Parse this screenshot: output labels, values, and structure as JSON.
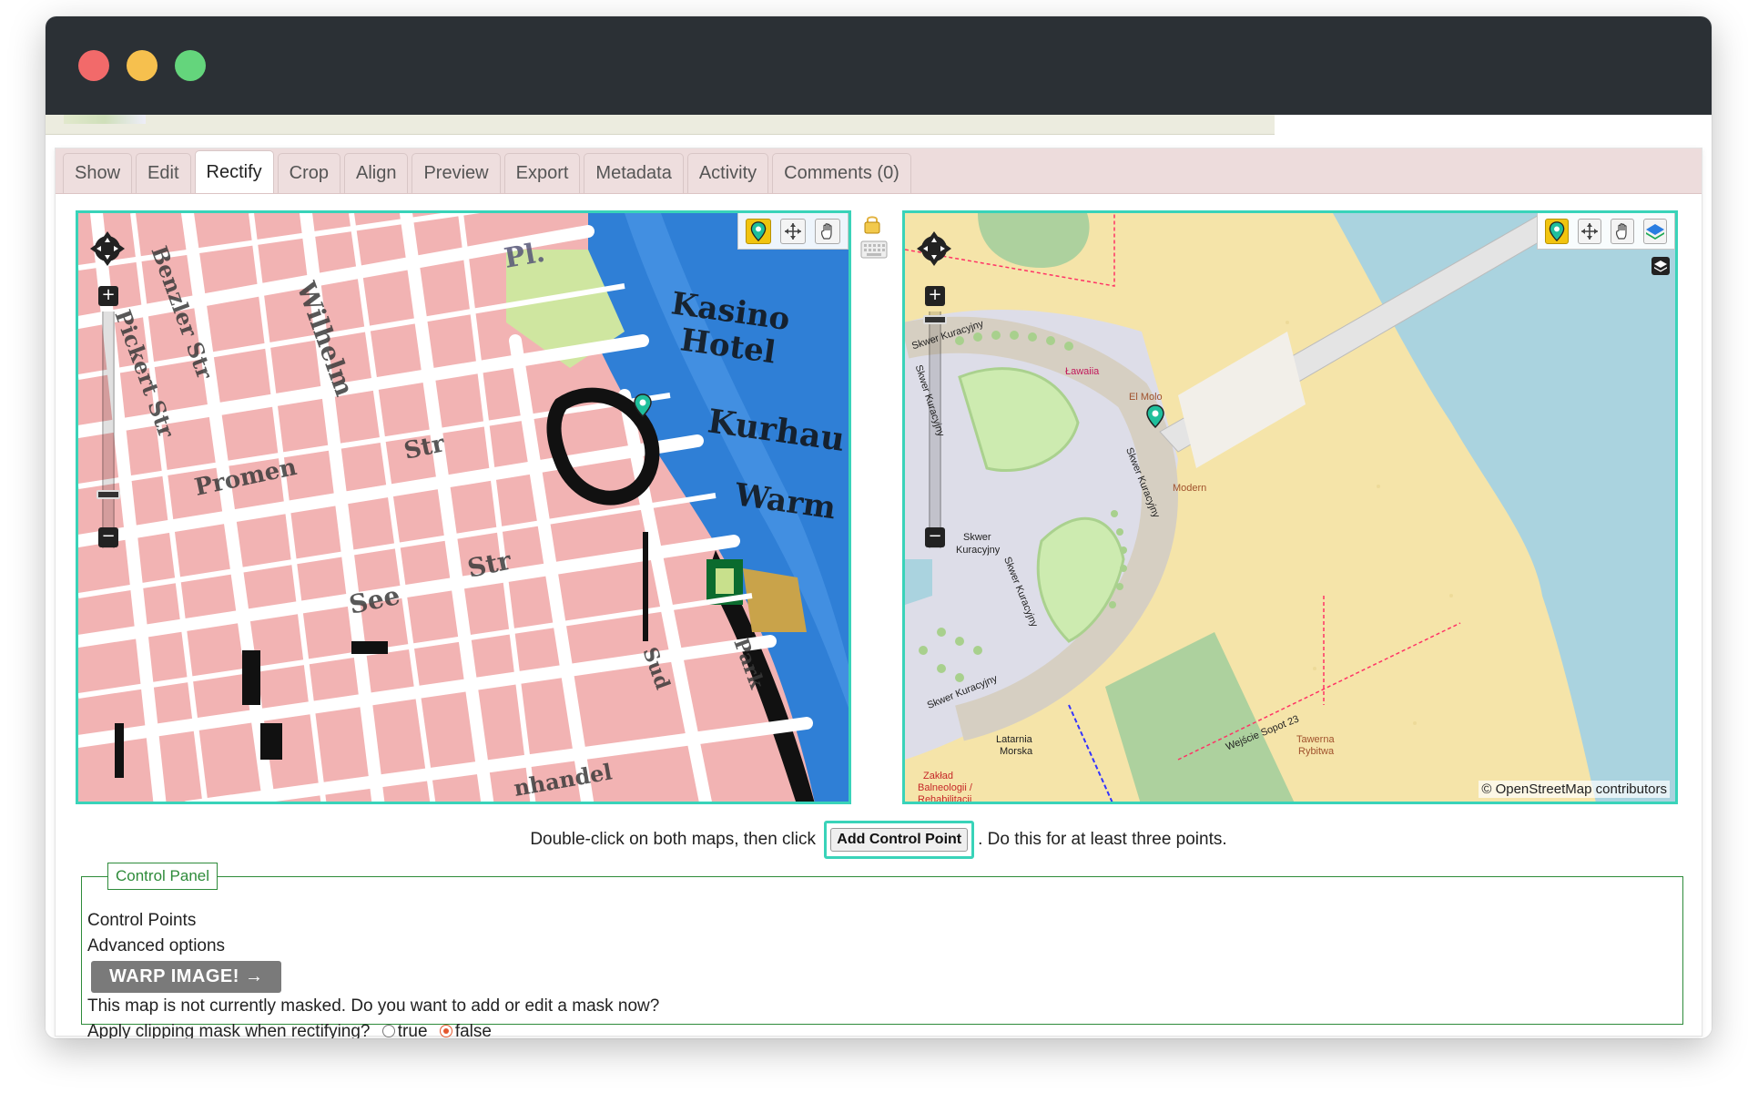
{
  "tabs": [
    {
      "label": "Show"
    },
    {
      "label": "Edit"
    },
    {
      "label": "Rectify"
    },
    {
      "label": "Crop"
    },
    {
      "label": "Align"
    },
    {
      "label": "Preview"
    },
    {
      "label": "Export"
    },
    {
      "label": "Metadata"
    },
    {
      "label": "Activity"
    },
    {
      "label": "Comments (0)"
    }
  ],
  "active_tab": "Rectify",
  "left_map": {
    "icons": [
      "pan-icon",
      "zoom-in-icon",
      "zoom-out-icon",
      "add-point-icon",
      "move-icon",
      "hand-icon"
    ]
  },
  "right_map": {
    "labels": {
      "skwer1": "Skwer Kuracyjny",
      "skwer2": "Skwer Kuracyjny",
      "skwer3": "Skwer Kuracyjny",
      "skwer4a": "Skwer",
      "skwer4b": "Kuracyjny",
      "skwer5": "Skwer Kuracyjny",
      "skwer6": "Skwer Kuracyjny",
      "lawaiia": "Ławaiia",
      "elmolo": "El Molo",
      "modern": "Modern",
      "latarnia1": "Latarnia",
      "latarnia2": "Morska",
      "zaklad1": "Zakład",
      "zaklad2": "Balneologii /",
      "zaklad3": "Rehabilitacji",
      "wejscie": "Wejście Sopot 23",
      "tawerna1": "Tawerna",
      "tawerna2": "Rybitwa"
    },
    "attribution": "© OpenStreetMap contributors",
    "icons": [
      "pan-icon",
      "zoom-in-icon",
      "zoom-out-icon",
      "add-point-icon",
      "move-icon",
      "hand-icon",
      "layer-icon",
      "layer-switcher-icon"
    ]
  },
  "hint": {
    "before": "Double-click on both maps, then click",
    "button": "Add Control Point",
    "after": ". Do this for at least three points."
  },
  "control_panel": {
    "legend": "Control Panel",
    "control_points": "Control Points",
    "advanced": "Advanced options",
    "warp_button": "WARP IMAGE! →",
    "mask_text": "This map is not currently masked. Do you want to add or edit a mask now?",
    "clip_label": "Apply clipping mask when rectifying?",
    "clip_options": [
      {
        "label": "true",
        "checked": false
      },
      {
        "label": "false",
        "checked": true
      }
    ]
  },
  "colors": {
    "accent": "#39d3b9",
    "panel_green": "#2e8b3a",
    "tabbar": "#eddcdc",
    "titlebar": "#2b3035"
  }
}
